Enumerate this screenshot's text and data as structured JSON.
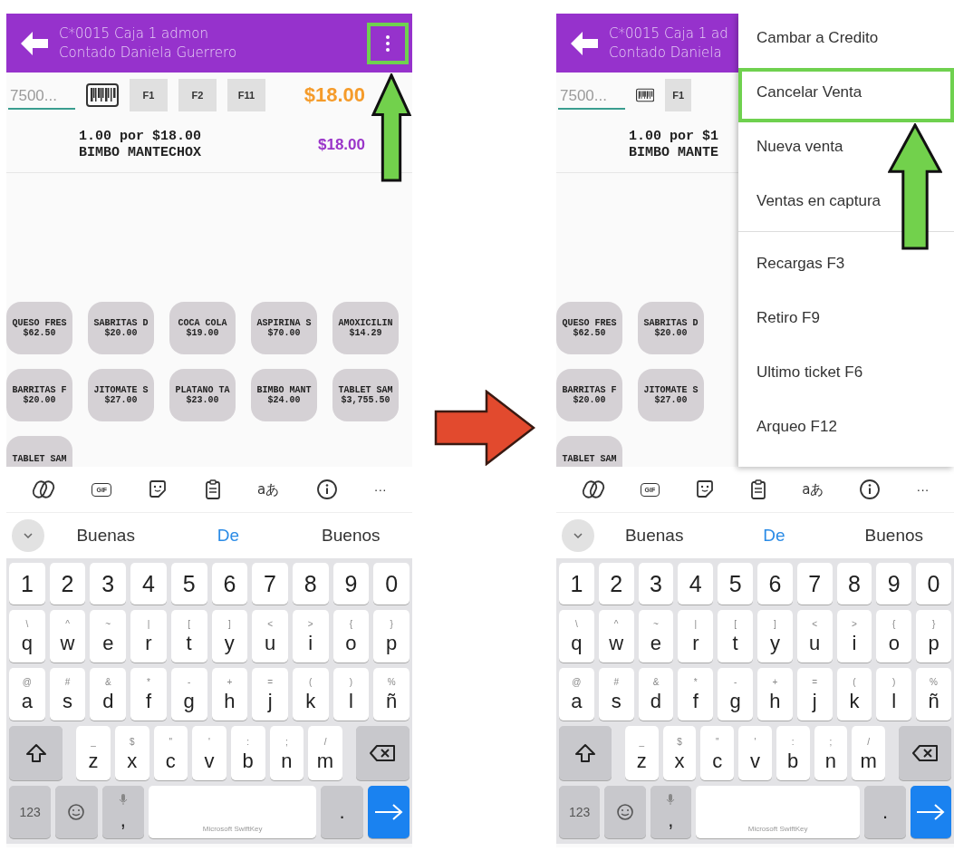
{
  "screens": [
    {
      "header": {
        "title": "C*0015 Caja 1 admon",
        "subtitle": "Contado Daniela Guerrero",
        "menu_button": {
          "highlighted": true
        }
      },
      "toolbar": {
        "search": {
          "placeholder": "7500..."
        },
        "function_keys": [
          "F1",
          "F2",
          "F11"
        ],
        "total": "$18.00"
      },
      "line_items": [
        {
          "quantity_line": "1.00 por $18.00",
          "name": "BIMBO MANTECHOX",
          "amount": "$18.00"
        }
      ],
      "products": [
        {
          "name": "QUESO FRES",
          "price": "$62.50"
        },
        {
          "name": "SABRITAS D",
          "price": "$20.00"
        },
        {
          "name": "COCA COLA",
          "price": "$19.00"
        },
        {
          "name": "ASPIRINA S",
          "price": "$70.00"
        },
        {
          "name": "AMOXICILIN",
          "price": "$14.29"
        },
        {
          "name": "BARRITAS F",
          "price": "$20.00"
        },
        {
          "name": "JITOMATE S",
          "price": "$27.00"
        },
        {
          "name": "PLATANO TA",
          "price": "$23.00"
        },
        {
          "name": "BIMBO MANT",
          "price": "$24.00"
        },
        {
          "name": "TABLET SAM",
          "price": "$3,755.50"
        },
        {
          "name": "TABLET SAM"
        }
      ],
      "keyboard": {
        "toolbar": [
          {
            "kind": "copilot"
          },
          {
            "kind": "gif",
            "label": "GIF"
          },
          {
            "kind": "sticker"
          },
          {
            "kind": "clipboard"
          },
          {
            "kind": "translate",
            "label": "aあ"
          },
          {
            "kind": "info"
          },
          {
            "kind": "more",
            "label": "···"
          }
        ],
        "suggestions": [
          {
            "text": "Buenas",
            "selected": false
          },
          {
            "text": "De",
            "selected": true
          },
          {
            "text": "Buenos",
            "selected": false
          }
        ],
        "rows": [
          {
            "kind": "numbers",
            "keys": [
              "1",
              "2",
              "3",
              "4",
              "5",
              "6",
              "7",
              "8",
              "9",
              "0"
            ]
          },
          {
            "kind": "letters",
            "keys": [
              "q",
              "w",
              "e",
              "r",
              "t",
              "y",
              "u",
              "i",
              "o",
              "p"
            ],
            "hints": [
              "\\",
              "^",
              "~",
              "|",
              "[",
              "]",
              "<",
              ">",
              "{",
              "}"
            ]
          },
          {
            "kind": "letters",
            "keys": [
              "a",
              "s",
              "d",
              "f",
              "g",
              "h",
              "j",
              "k",
              "l",
              "ñ"
            ],
            "hints": [
              "@",
              "#",
              "&",
              "*",
              "-",
              "+",
              "=",
              "(",
              ")",
              "%"
            ]
          },
          {
            "kind": "shift",
            "keys": [
              "z",
              "x",
              "c",
              "v",
              "b",
              "n",
              "m"
            ],
            "hints": [
              "_",
              "$",
              "\"",
              "'",
              ":",
              ";",
              "/"
            ]
          },
          {
            "kind": "bottom",
            "mode_key": "123",
            "comma": ",",
            "space": "Microsoft SwiftKey",
            "period": "."
          }
        ]
      }
    },
    {
      "header": {
        "title": "C*0015 Caja 1 ad",
        "subtitle": "Contado Daniela"
      },
      "toolbar": {
        "search": {
          "placeholder": "7500..."
        },
        "function_keys": [
          "F1"
        ]
      },
      "line_items": [
        {
          "quantity_line": "1.00 por $1",
          "name": "BIMBO MANTE"
        }
      ],
      "products": [
        {
          "name": "QUESO FRES",
          "price": "$62.50"
        },
        {
          "name": "SABRITAS D",
          "price": "$20.00"
        },
        {
          "name": "BARRITAS F",
          "price": "$20.00"
        },
        {
          "name": "JITOMATE S",
          "price": "$27.00"
        },
        {
          "name": "TABLET SAM"
        }
      ],
      "menu": {
        "sections": [
          {
            "items": [
              {
                "label": "Cambar a Credito",
                "highlighted": false
              },
              {
                "label": "Cancelar Venta",
                "highlighted": true
              },
              {
                "label": "Nueva venta",
                "highlighted": false
              },
              {
                "label": "Ventas en captura",
                "highlighted": false
              }
            ]
          },
          {
            "items": [
              {
                "label": "Recargas F3",
                "highlighted": false
              },
              {
                "label": "Retiro F9",
                "highlighted": false
              },
              {
                "label": "Ultimo ticket F6",
                "highlighted": false
              },
              {
                "label": "Arqueo F12",
                "highlighted": false
              }
            ]
          }
        ]
      },
      "keyboard": {
        "toolbar": [
          {
            "kind": "copilot"
          },
          {
            "kind": "gif",
            "label": "GIF"
          },
          {
            "kind": "sticker"
          },
          {
            "kind": "clipboard"
          },
          {
            "kind": "translate",
            "label": "aあ"
          },
          {
            "kind": "info"
          },
          {
            "kind": "more",
            "label": "···"
          }
        ],
        "suggestions": [
          {
            "text": "Buenas",
            "selected": false
          },
          {
            "text": "De",
            "selected": true
          },
          {
            "text": "Buenos",
            "selected": false
          }
        ],
        "rows": [
          {
            "kind": "numbers",
            "keys": [
              "1",
              "2",
              "3",
              "4",
              "5",
              "6",
              "7",
              "8",
              "9",
              "0"
            ]
          },
          {
            "kind": "letters",
            "keys": [
              "q",
              "w",
              "e",
              "r",
              "t",
              "y",
              "u",
              "i",
              "o",
              "p"
            ],
            "hints": [
              "\\",
              "^",
              "~",
              "|",
              "[",
              "]",
              "<",
              ">",
              "{",
              "}"
            ]
          },
          {
            "kind": "letters",
            "keys": [
              "a",
              "s",
              "d",
              "f",
              "g",
              "h",
              "j",
              "k",
              "l",
              "ñ"
            ],
            "hints": [
              "@",
              "#",
              "&",
              "*",
              "-",
              "+",
              "=",
              "(",
              ")",
              "%"
            ]
          },
          {
            "kind": "shift",
            "keys": [
              "z",
              "x",
              "c",
              "v",
              "b",
              "n",
              "m"
            ],
            "hints": [
              "_",
              "$",
              "\"",
              "'",
              ":",
              ";",
              "/"
            ]
          },
          {
            "kind": "bottom",
            "mode_key": "123",
            "comma": ",",
            "space": "Microsoft SwiftKey",
            "period": "."
          }
        ]
      }
    }
  ]
}
